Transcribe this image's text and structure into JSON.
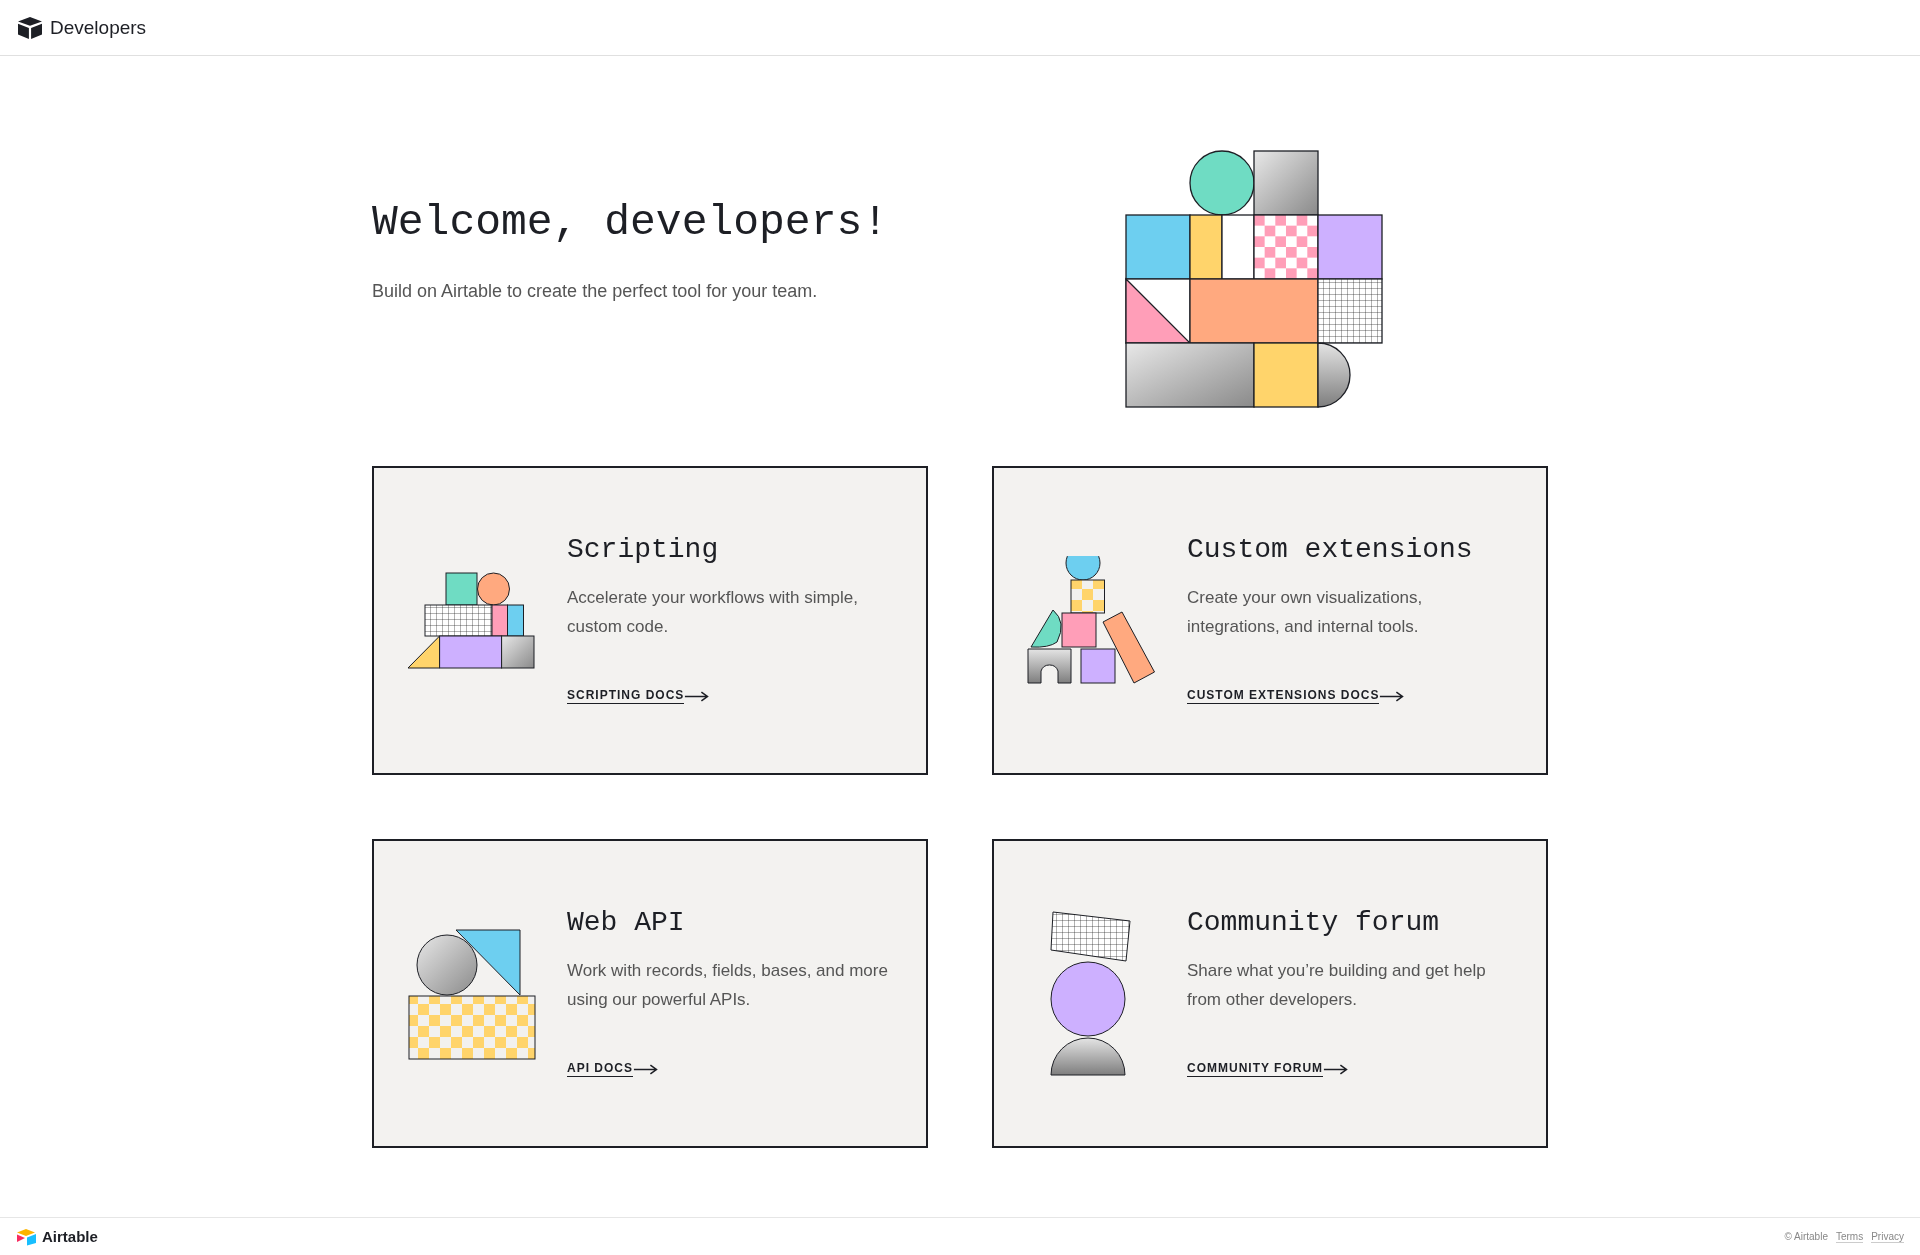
{
  "header": {
    "title": "Developers"
  },
  "hero": {
    "title": "Welcome, developers!",
    "subtitle": "Build on Airtable to create the perfect tool for your team."
  },
  "cards": [
    {
      "title": "Scripting",
      "description": "Accelerate your workflows with simple, custom code.",
      "link": "SCRIPTING DOCS"
    },
    {
      "title": "Custom extensions",
      "description": "Create your own visualizations, integrations, and internal tools.",
      "link": "CUSTOM EXTENSIONS DOCS"
    },
    {
      "title": "Web API",
      "description": "Work with records, fields, bases, and more using our powerful APIs.",
      "link": "API DOCS"
    },
    {
      "title": "Community forum",
      "description": "Share what you’re building and get help from other developers.",
      "link": "COMMUNITY FORUM"
    }
  ],
  "footer": {
    "brand": "Airtable",
    "copyright": "© Airtable",
    "links": [
      "Terms",
      "Privacy"
    ]
  }
}
